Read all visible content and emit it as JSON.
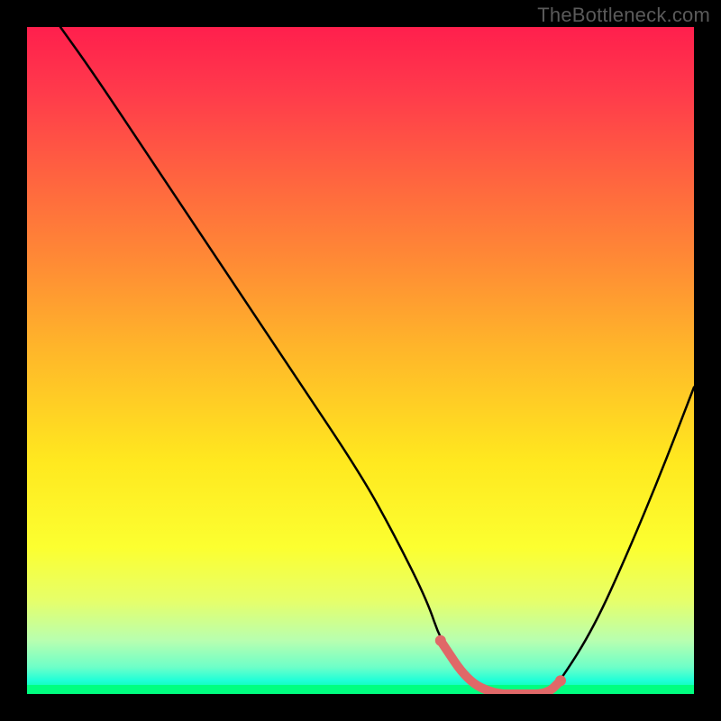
{
  "watermark": "TheBottleneck.com",
  "chart_data": {
    "type": "line",
    "title": "",
    "xlabel": "",
    "ylabel": "",
    "xlim": [
      0,
      100
    ],
    "ylim": [
      0,
      100
    ],
    "series": [
      {
        "name": "curve",
        "x": [
          5,
          10,
          20,
          30,
          40,
          50,
          55,
          60,
          62,
          66,
          70,
          74,
          78,
          80,
          85,
          90,
          95,
          100
        ],
        "values": [
          100,
          93,
          78,
          63,
          48,
          33,
          24,
          14,
          8,
          2,
          0,
          0,
          0,
          2,
          10,
          21,
          33,
          46
        ]
      }
    ],
    "highlight": {
      "name": "optimal-range",
      "x_start": 62,
      "x_end": 80,
      "color": "#e06868"
    },
    "background_gradient": {
      "top_color": "#ff1f4d",
      "mid_color": "#ffe81f",
      "bottom_color": "#00ff94"
    }
  }
}
